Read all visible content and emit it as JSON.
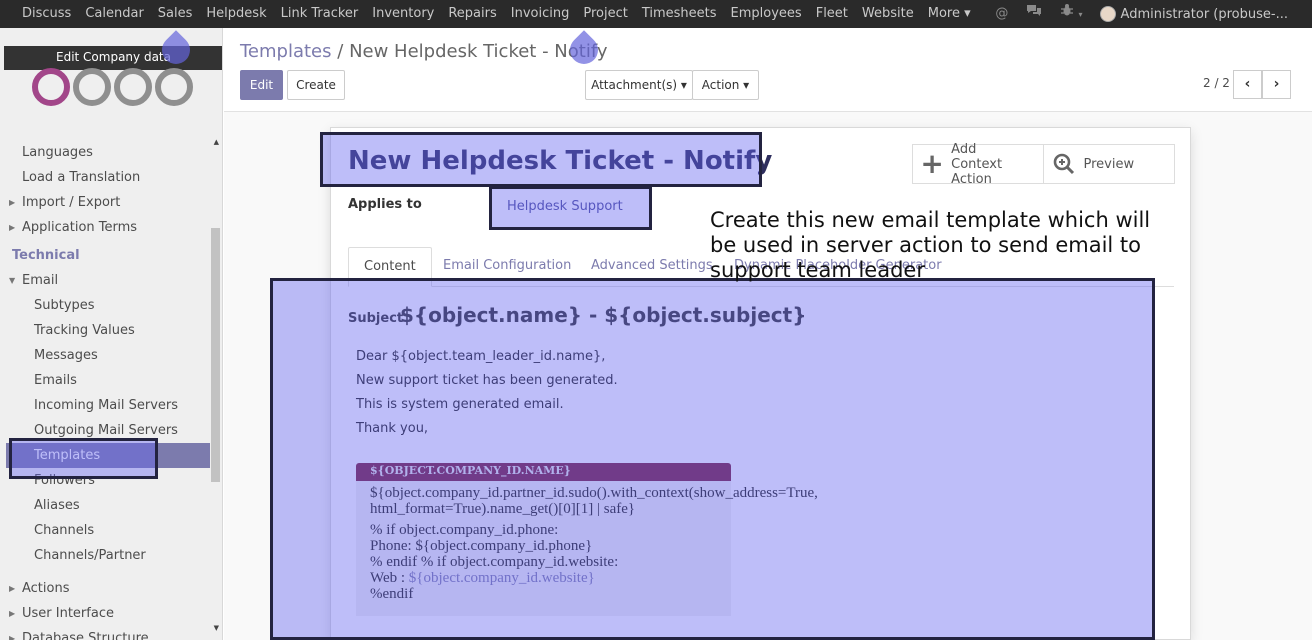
{
  "topbar": {
    "menu": [
      "Discuss",
      "Calendar",
      "Sales",
      "Helpdesk",
      "Link Tracker",
      "Inventory",
      "Repairs",
      "Invoicing",
      "Project",
      "Timesheets",
      "Employees",
      "Fleet",
      "Website",
      "More ▾"
    ],
    "user": "Administrator (probuse-..."
  },
  "sidebar": {
    "edit_company": "Edit Company data",
    "items_top": [
      {
        "label": "Languages",
        "caret": false
      },
      {
        "label": "Load a Translation",
        "caret": false
      },
      {
        "label": "Import / Export",
        "caret": true
      },
      {
        "label": "Application Terms",
        "caret": true
      }
    ],
    "technical_header": "Technical",
    "email_label": "Email",
    "email_items": [
      "Subtypes",
      "Tracking Values",
      "Messages",
      "Emails",
      "Incoming Mail Servers",
      "Outgoing Mail Servers",
      "Templates",
      "Followers",
      "Aliases",
      "Channels",
      "Channels/Partner"
    ],
    "active_item": "Templates",
    "items_bottom": [
      "Actions",
      "User Interface",
      "Database Structure"
    ]
  },
  "control_panel": {
    "breadcrumb_parent": "Templates",
    "breadcrumb_sep": "/",
    "breadcrumb_current": "New Helpdesk Ticket - Notify",
    "edit_label": "Edit",
    "create_label": "Create",
    "attachments_label": "Attachment(s) ▾",
    "action_label": "Action ▾",
    "pager": "2 / 2"
  },
  "form": {
    "title": "New Helpdesk Ticket - Notify",
    "add_context_line1": "Add",
    "add_context_line2": "Context Action",
    "preview_label": "Preview",
    "applies_to_label": "Applies to",
    "applies_to_value": "Helpdesk Support",
    "tabs": [
      "Content",
      "Email Configuration",
      "Advanced Settings",
      "Dynamic Placeholder Generator"
    ],
    "active_tab": "Content",
    "subject_label": "Subject",
    "subject_value": "${object.name} - ${object.subject}",
    "body_lines": [
      "Dear ${object.team_leader_id.name},",
      "New support ticket has been generated.",
      "This is system generated email.",
      "Thank you,"
    ],
    "footer_header": "${OBJECT.COMPANY_ID.NAME}",
    "footer_lines": [
      "${object.company_id.partner_id.sudo().with_context(show_address=True,",
      "html_format=True).name_get()[0][1] | safe}",
      "% if object.company_id.phone:",
      "Phone:  ${object.company_id.phone}",
      "% endif % if object.company_id.website:",
      "Web : ",
      "${object.company_id.website}",
      "%endif"
    ]
  },
  "annotation": "Create this new email template which will be used in server action to send email to support team leader",
  "colors": {
    "brand": "#7c7bad",
    "navbar": "#2a2a2a",
    "highlight": "#6464f0",
    "footer_header": "#7b1e3e"
  }
}
